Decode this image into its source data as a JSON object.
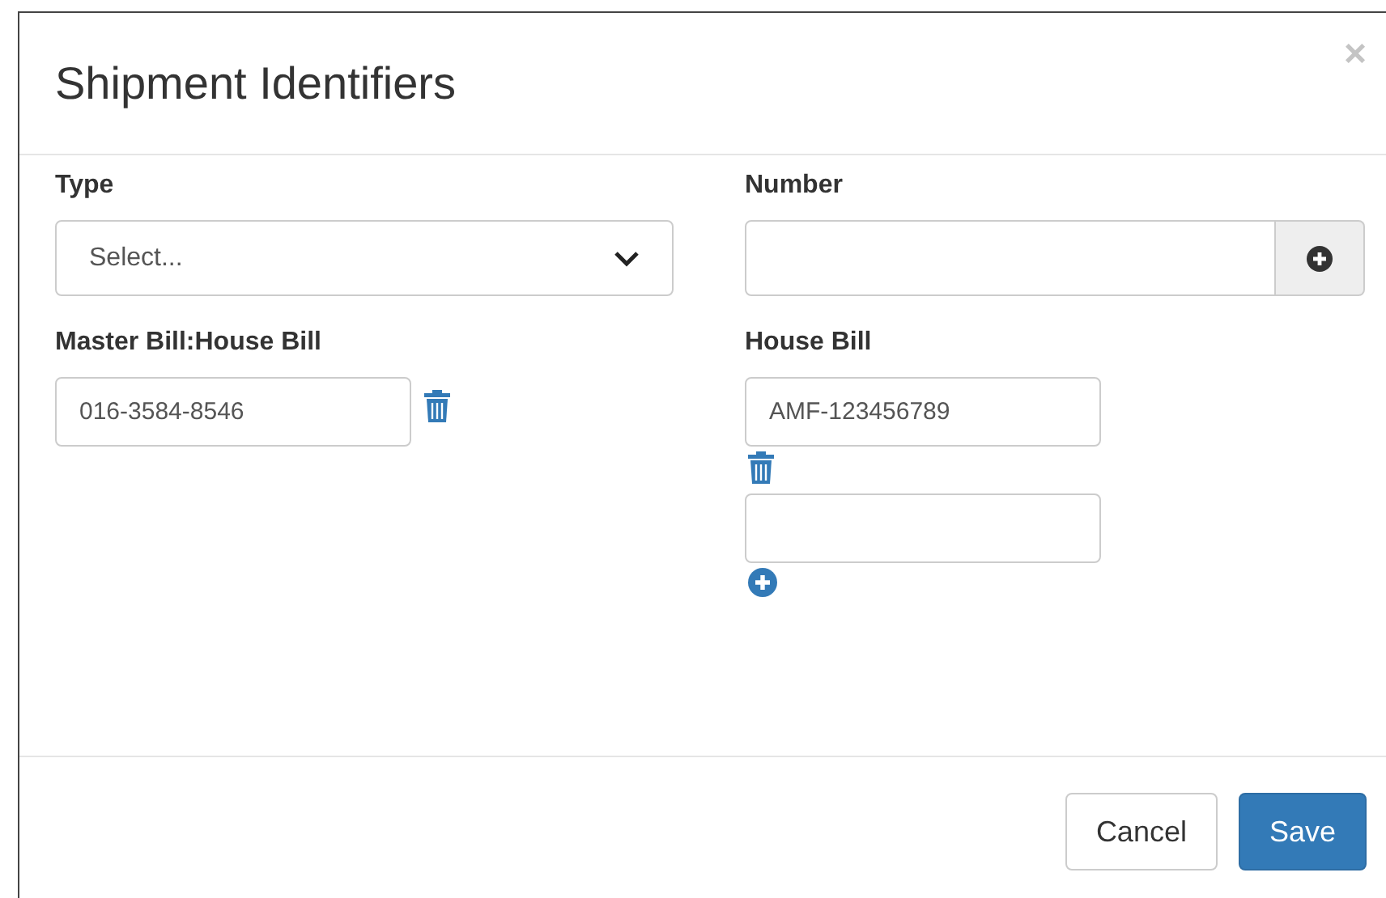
{
  "dialog": {
    "title": "Shipment Identifiers",
    "close": "×"
  },
  "type_field": {
    "label": "Type",
    "placeholder": "Select..."
  },
  "number_field": {
    "label": "Number"
  },
  "master_bill": {
    "label": "Master Bill:House Bill",
    "entries": [
      {
        "kind": "existing",
        "value": "016-3584-8546"
      }
    ]
  },
  "house_bill": {
    "label": "House Bill",
    "entries": [
      {
        "kind": "existing",
        "value": "AMF-123456789"
      },
      {
        "kind": "new"
      }
    ]
  },
  "buttons": [
    {
      "label": "Cancel",
      "kind": "default"
    },
    {
      "label": "Save",
      "kind": "primary"
    }
  ]
}
